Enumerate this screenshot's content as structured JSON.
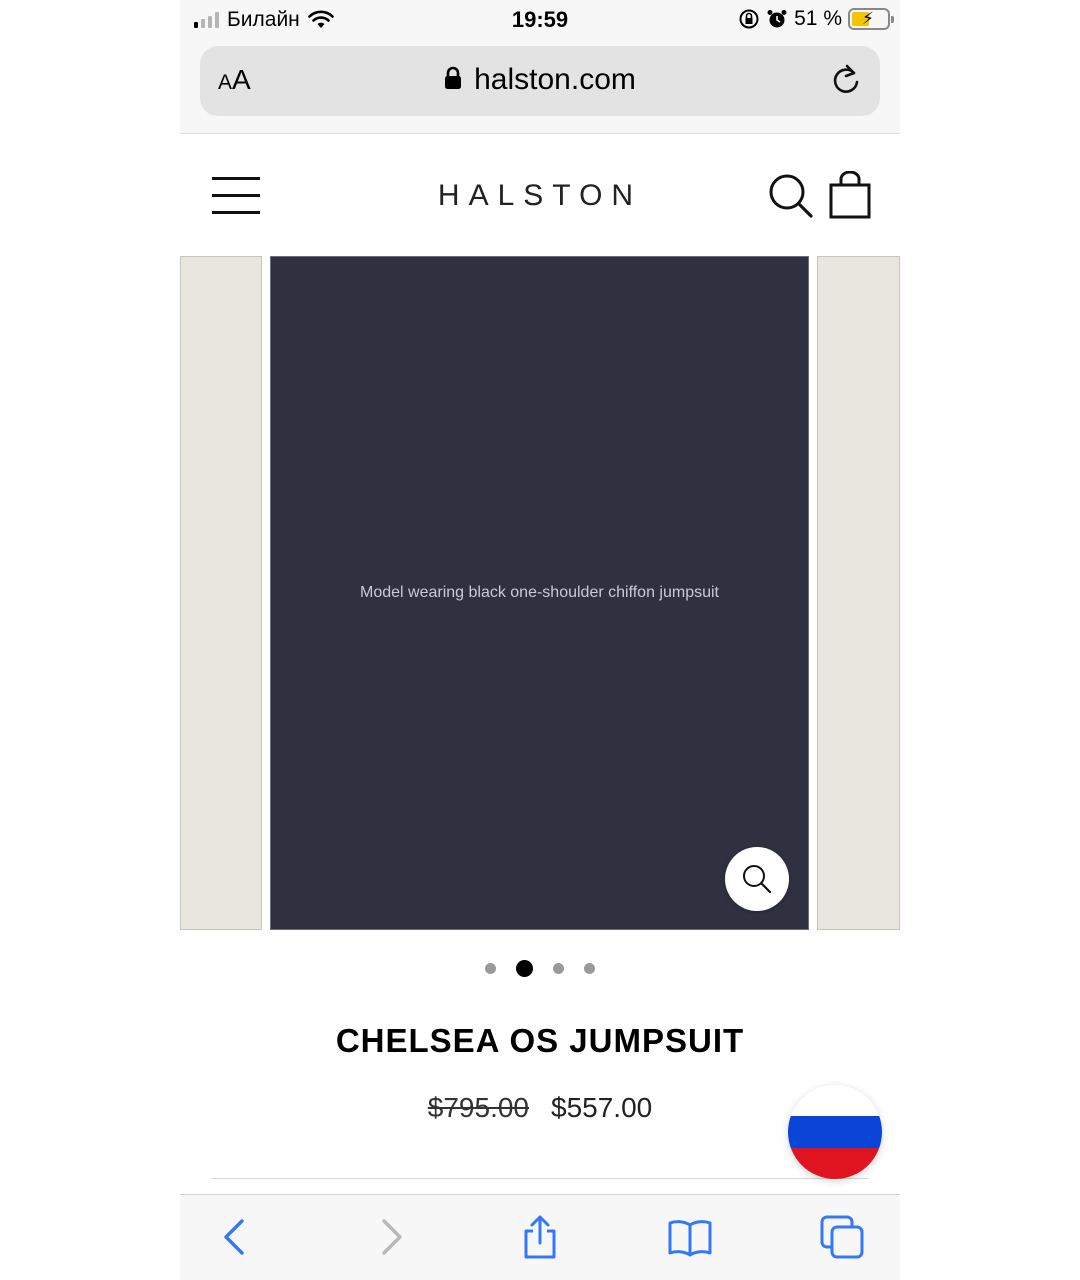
{
  "status_bar": {
    "carrier": "Билайн",
    "time": "19:59",
    "battery_percent": "51 %",
    "battery_level": 0.51,
    "battery_color": "#f2c500"
  },
  "browser": {
    "text_size_label_small": "A",
    "text_size_label_large": "A",
    "url": "halston.com"
  },
  "site": {
    "brand": "HALSTON"
  },
  "gallery": {
    "main_image_label": "Model wearing black one-shoulder chiffon jumpsuit",
    "prev_image_label": "",
    "next_image_label": "",
    "slide_count": 4,
    "active_slide": 2
  },
  "product": {
    "title": "CHELSEA OS JUMPSUIT",
    "original_price": "$795.00",
    "sale_price": "$557.00"
  },
  "colors": {
    "link_blue": "#3478f6",
    "disabled_gray": "#b8b8b8",
    "flag_white": "#ffffff",
    "flag_blue": "#0a45d8",
    "flag_red": "#e01421"
  },
  "icons": [
    "signal-icon",
    "wifi-icon",
    "orientation-lock-icon",
    "alarm-icon",
    "battery-icon",
    "lock-icon",
    "reload-icon",
    "menu-icon",
    "search-icon",
    "bag-icon",
    "zoom-icon",
    "back-icon",
    "forward-icon",
    "share-icon",
    "bookmarks-icon",
    "tabs-icon"
  ]
}
